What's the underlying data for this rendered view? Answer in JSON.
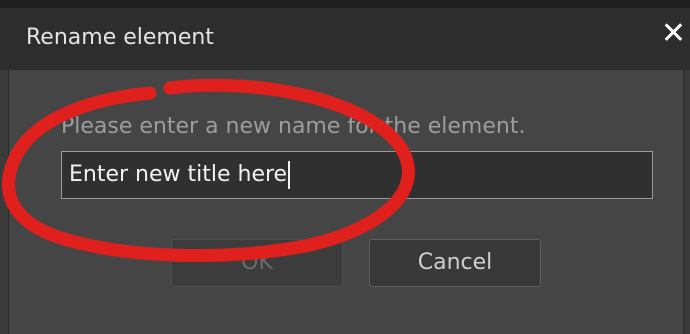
{
  "dialog": {
    "title": "Rename element",
    "close_glyph": "✕",
    "prompt": "Please enter a new name for the element.",
    "input_value": "Enter new title here",
    "ok_label": "OK",
    "cancel_label": "Cancel"
  },
  "annotation": {
    "color": "#e0201c"
  }
}
